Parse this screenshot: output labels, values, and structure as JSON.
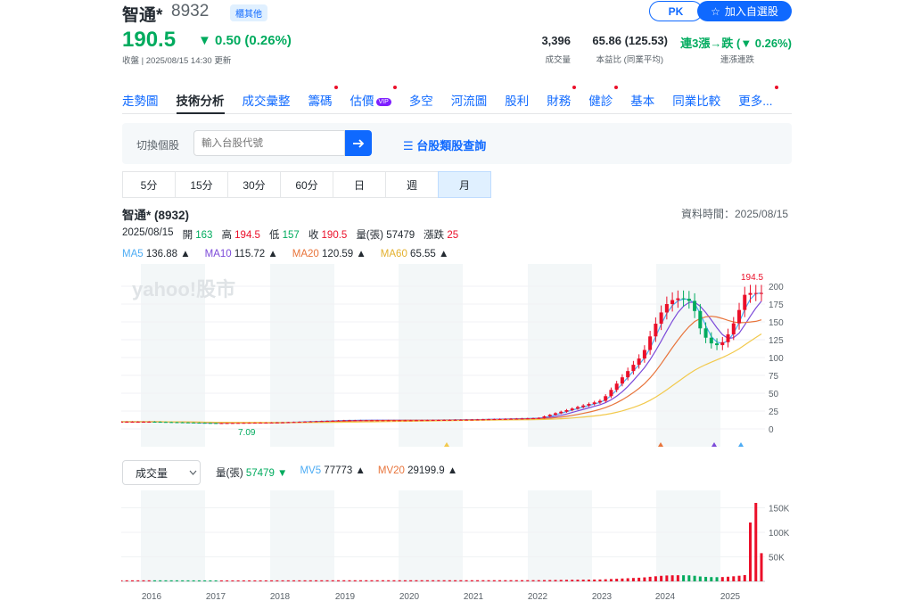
{
  "stock": {
    "name": "智通*",
    "code": "8932",
    "tag": "櫃其他",
    "price": "190.5",
    "change": "▼ 0.50 (0.26%)",
    "subtitle": "收盤 | 2025/08/15 14:30 更新"
  },
  "actions": {
    "pk": "PK",
    "add_watchlist": "加入自選股"
  },
  "stats": [
    {
      "value": "3,396",
      "label": "成交量"
    },
    {
      "value": "65.86 (125.53)",
      "label": "本益比 (同業平均)"
    },
    {
      "value": "連3漲→跌 (▼ 0.26%)",
      "label": "連漲連跌"
    }
  ],
  "nav": [
    {
      "label": "走勢圖"
    },
    {
      "label": "技術分析"
    },
    {
      "label": "成交彙整"
    },
    {
      "label": "籌碼"
    },
    {
      "label": "估價"
    },
    {
      "label": "多空"
    },
    {
      "label": "河流圖"
    },
    {
      "label": "股利"
    },
    {
      "label": "財務"
    },
    {
      "label": "健診"
    },
    {
      "label": "基本"
    },
    {
      "label": "同業比較"
    },
    {
      "label": "更多..."
    }
  ],
  "nav_vip": "VIP",
  "search": {
    "label": "切換個股",
    "placeholder": "輸入台股代號",
    "class_link": "台股類股查詢"
  },
  "periods": [
    "5分",
    "15分",
    "30分",
    "60分",
    "日",
    "週",
    "月"
  ],
  "chart_header": {
    "title": "智通* (8932)",
    "data_time": "資料時間：2025/08/15"
  },
  "ohlc": {
    "date": "2025/08/15",
    "open_label": "開",
    "open": "163",
    "high_label": "高",
    "high": "194.5",
    "low_label": "低",
    "low": "157",
    "close_label": "收",
    "close": "190.5",
    "vol_label": "量(張)",
    "vol": "57479",
    "chg_label": "漲跌",
    "chg": "25"
  },
  "ma": [
    {
      "label": "MA5",
      "value": "136.88 ▲",
      "color": "#4dacf4"
    },
    {
      "label": "MA10",
      "value": "115.72 ▲",
      "color": "#7c4ad9"
    },
    {
      "label": "MA20",
      "value": "120.59 ▲",
      "color": "#e8743b"
    },
    {
      "label": "MA60",
      "value": "65.55 ▲",
      "color": "#f2c94c"
    }
  ],
  "watermark": "yahoo!股市",
  "volume": {
    "selector": "成交量",
    "vol_label": "量(張)",
    "vol": "57479 ▼",
    "mv5_label": "MV5",
    "mv5": "77773 ▲",
    "mv20_label": "MV20",
    "mv20": "29199.9 ▲"
  },
  "chart_data": {
    "type": "candlestick",
    "price_axis_ticks": [
      "200",
      "175",
      "150",
      "125",
      "100",
      "75",
      "50",
      "25",
      "0"
    ],
    "price_ylim": [
      0,
      200
    ],
    "high_marker": "194.5",
    "low_marker": "7.09",
    "volume_axis_ticks": [
      "150K",
      "100K",
      "50K"
    ],
    "x_ticks": [
      "2016",
      "2017",
      "2018",
      "2019",
      "2020",
      "2021",
      "2022",
      "2023",
      "2024",
      "2025"
    ],
    "monthly_close_estimates": [
      {
        "x": "2016",
        "close": 10
      },
      {
        "x": "2017",
        "close": 8
      },
      {
        "x": "2018",
        "close": 9
      },
      {
        "x": "2019",
        "close": 12
      },
      {
        "x": "2020",
        "close": 12
      },
      {
        "x": "2021",
        "close": 13
      },
      {
        "x": "2022",
        "close": 15
      },
      {
        "x": "2023",
        "close": 40
      },
      {
        "x": "2024",
        "close": 140
      },
      {
        "x": "2025",
        "close": 190.5
      }
    ]
  }
}
